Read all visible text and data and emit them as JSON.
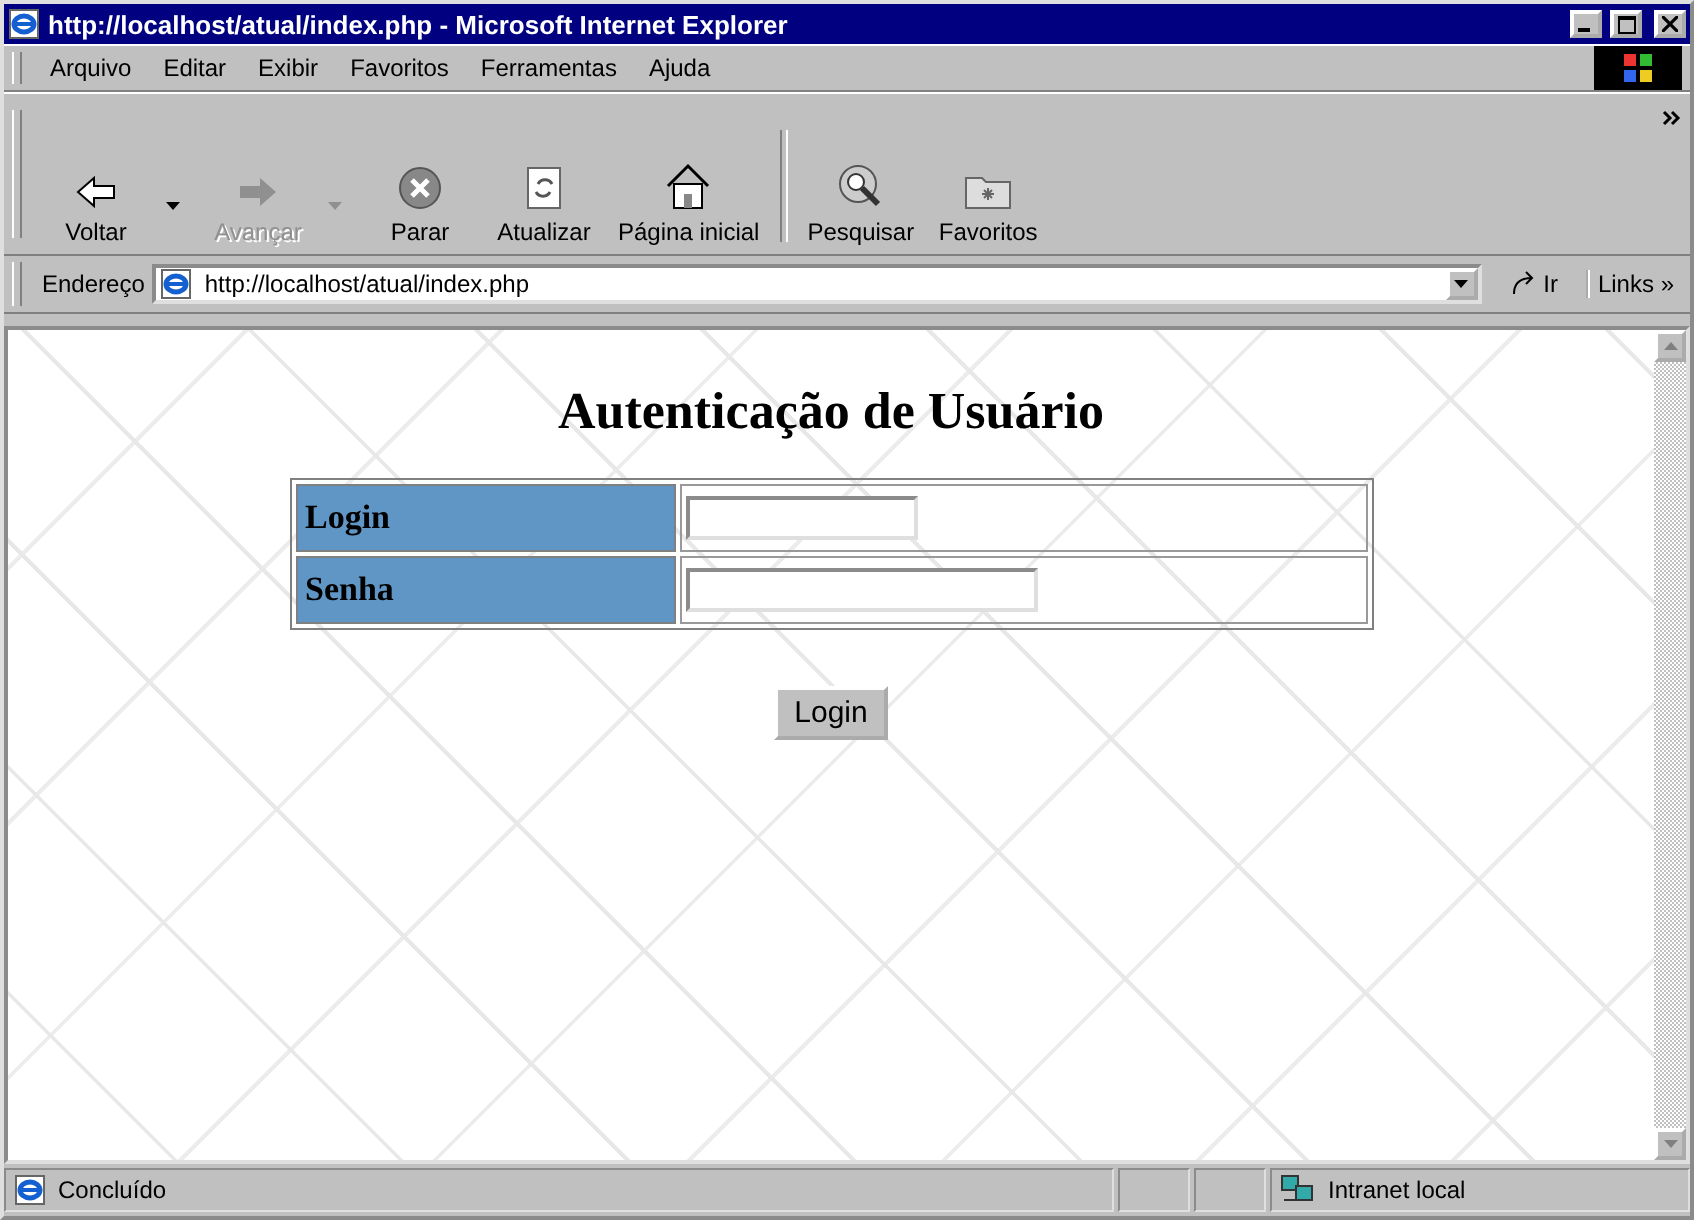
{
  "window": {
    "title": "http://localhost/atual/index.php - Microsoft Internet Explorer"
  },
  "menu": [
    "Arquivo",
    "Editar",
    "Exibir",
    "Favoritos",
    "Ferramentas",
    "Ajuda"
  ],
  "toolbar": [
    {
      "label": "Voltar",
      "disabled": false,
      "dropdown": true
    },
    {
      "label": "Avançar",
      "disabled": true,
      "dropdown": true
    },
    {
      "label": "Parar",
      "disabled": false,
      "dropdown": false
    },
    {
      "label": "Atualizar",
      "disabled": false,
      "dropdown": false
    },
    {
      "label": "Página inicial",
      "disabled": false,
      "dropdown": false
    },
    {
      "label": "Pesquisar",
      "disabled": false,
      "dropdown": false
    },
    {
      "label": "Favoritos",
      "disabled": false,
      "dropdown": false
    }
  ],
  "address_bar": {
    "label": "Endereço",
    "value": "http://localhost/atual/index.php",
    "go": "Ir",
    "links": "Links",
    "links_more": "»"
  },
  "page": {
    "heading": "Autenticação de Usuário",
    "fields": [
      {
        "label": "Login",
        "kind": "text"
      },
      {
        "label": "Senha",
        "kind": "password"
      }
    ],
    "button": "Login"
  },
  "status_bar": {
    "text": "Concluído",
    "zone": "Intranet local"
  }
}
